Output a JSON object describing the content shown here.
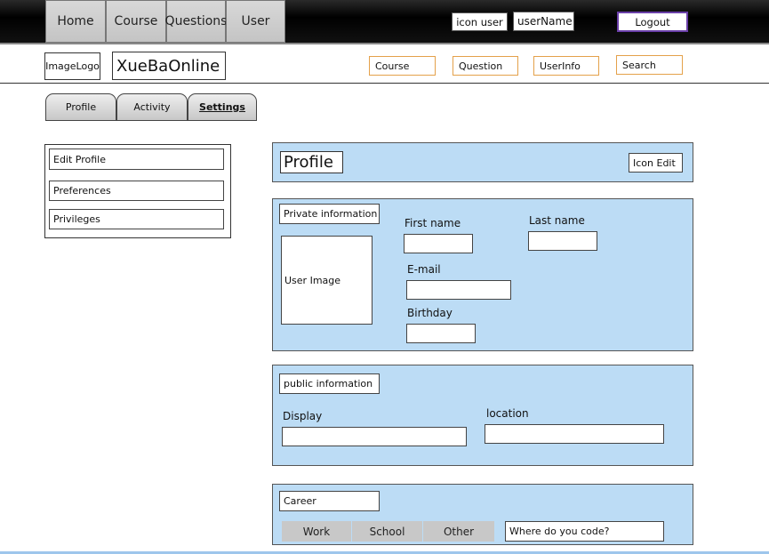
{
  "topnav": {
    "items": [
      {
        "label": "Home"
      },
      {
        "label": "Course"
      },
      {
        "label": "Questions"
      },
      {
        "label": "User"
      }
    ],
    "icon_user": "icon user",
    "username": "userName",
    "logout": "Logout"
  },
  "header": {
    "logo": "ImageLogo",
    "site_name": "XueBaOnline",
    "links": [
      {
        "label": "Course"
      },
      {
        "label": "Question"
      },
      {
        "label": "UserInfo"
      }
    ],
    "search": "Search"
  },
  "tabs": [
    {
      "label": "Profile",
      "active": false
    },
    {
      "label": "Activity",
      "active": false
    },
    {
      "label": "Settings",
      "active": true
    }
  ],
  "sidemenu": {
    "items": [
      {
        "label": "Edit Profile"
      },
      {
        "label": "Preferences"
      },
      {
        "label": "Privileges"
      }
    ]
  },
  "profile": {
    "title": "Profile",
    "icon_edit": "Icon Edit"
  },
  "private": {
    "title": "Private information",
    "user_image": "User Image",
    "first_name": "First name",
    "last_name": "Last name",
    "email": "E-mail",
    "birthday": "Birthday"
  },
  "public": {
    "title": "public information",
    "display": "Display",
    "location": "location"
  },
  "career": {
    "title": "Career",
    "segments": [
      {
        "label": "Work"
      },
      {
        "label": "School"
      },
      {
        "label": "Other"
      }
    ],
    "code_placeholder": "Where do you code?"
  }
}
